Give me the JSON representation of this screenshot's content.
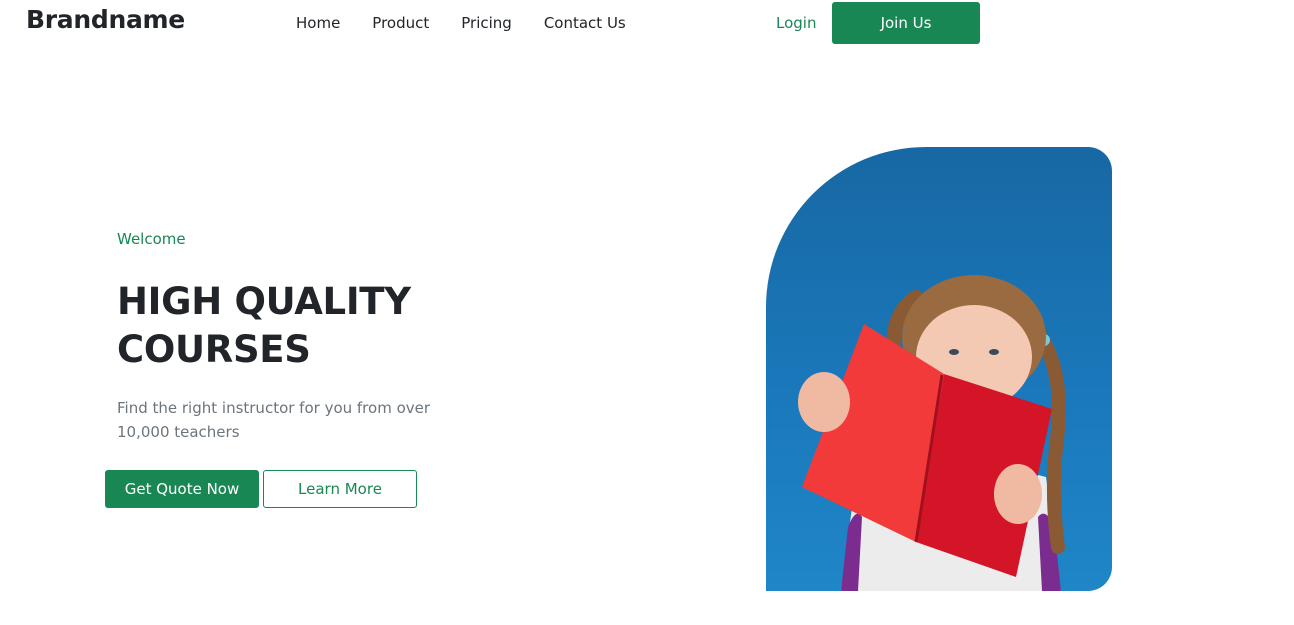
{
  "header": {
    "brand": "Brandname",
    "nav": [
      "Home",
      "Product",
      "Pricing",
      "Contact Us"
    ],
    "login_label": "Login",
    "join_label": "Join Us"
  },
  "hero": {
    "eyebrow": "Welcome",
    "title": "HIGH QUALITY COURSES",
    "description": "Find the right instructor for you from over 10,000 teachers",
    "primary_button": "Get Quote Now",
    "secondary_button": "Learn More"
  },
  "colors": {
    "accent": "#198754",
    "text": "#212529",
    "muted": "#6c757d",
    "image_bg": "#1a78bb"
  }
}
